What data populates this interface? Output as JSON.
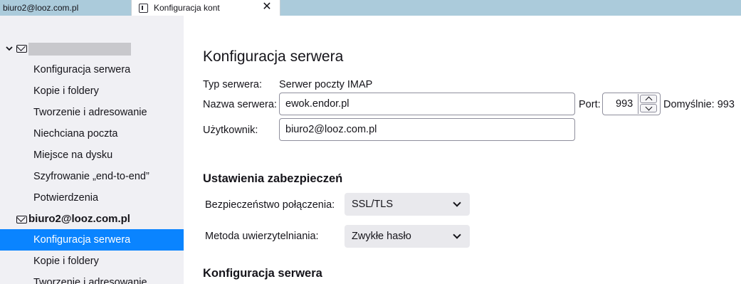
{
  "tabs": {
    "inactive_label": "biuro2@looz.com.pl",
    "active_label": "Konfiguracja kont",
    "close_glyph": "✕"
  },
  "sidebar": {
    "accounts": [
      {
        "label": "",
        "redacted": true,
        "expanded": true,
        "items": [
          {
            "label": "Konfiguracja serwera",
            "selected": false
          },
          {
            "label": "Kopie i foldery",
            "selected": false
          },
          {
            "label": "Tworzenie i adresowanie",
            "selected": false
          },
          {
            "label": "Niechciana poczta",
            "selected": false
          },
          {
            "label": "Miejsce na dysku",
            "selected": false
          },
          {
            "label": "Szyfrowanie „end-to-end”",
            "selected": false
          },
          {
            "label": "Potwierdzenia",
            "selected": false
          }
        ]
      },
      {
        "label": "biuro2@looz.com.pl",
        "redacted": false,
        "expanded": false,
        "items": [
          {
            "label": "Konfiguracja serwera",
            "selected": true
          },
          {
            "label": "Kopie i foldery",
            "selected": false
          },
          {
            "label": "Tworzenie i adresowanie",
            "selected": false
          }
        ]
      }
    ]
  },
  "main": {
    "title": "Konfiguracja serwera",
    "server_type_label": "Typ serwera:",
    "server_type_value": "Serwer poczty IMAP",
    "server_name_label": "Nazwa serwera:",
    "server_name_value": "ewok.endor.pl",
    "port_label": "Port:",
    "port_value": "993",
    "port_default": "Domyślnie: 993",
    "user_label": "Użytkownik:",
    "user_value": "biuro2@looz.com.pl",
    "security_heading": "Ustawienia zabezpieczeń",
    "connection_security_label": "Bezpieczeństwo połączenia:",
    "connection_security_value": "SSL/TLS",
    "auth_method_label": "Metoda uwierzytelniania:",
    "auth_method_value": "Zwykłe hasło",
    "server_settings_heading": "Konfiguracja serwera"
  },
  "colors": {
    "tabbar": "#abcbdb",
    "sidebar": "#f0f0f4",
    "selection": "#0a84ff",
    "select_bg": "#e9e9ed"
  },
  "icons": [
    "document-tab-icon",
    "close-icon",
    "chevron-down-icon",
    "mail-icon",
    "spinner-up-icon",
    "spinner-down-icon",
    "dropdown-arrow-icon"
  ]
}
